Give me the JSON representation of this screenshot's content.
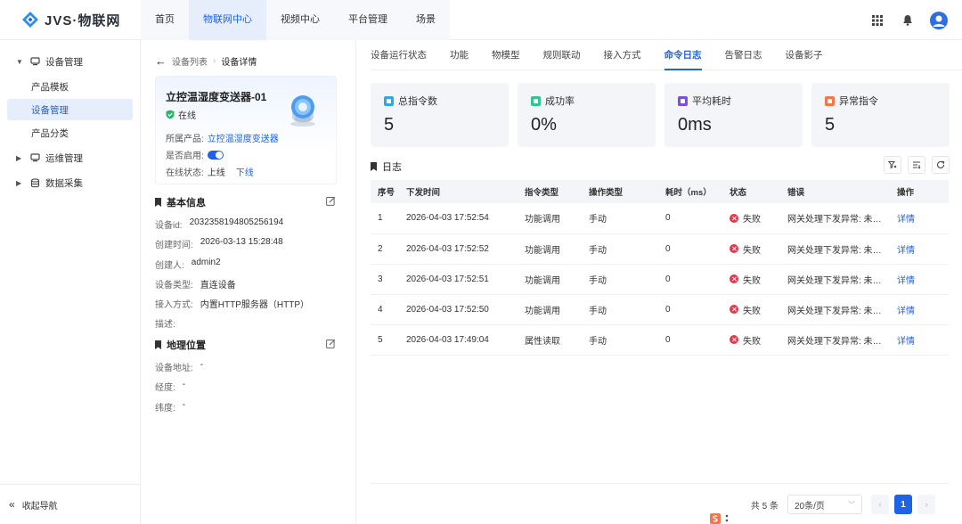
{
  "app": {
    "logo_text": "JVS·物联网"
  },
  "topnav": [
    {
      "label": "首页",
      "active": false
    },
    {
      "label": "物联网中心",
      "active": true
    },
    {
      "label": "视频中心",
      "active": false
    },
    {
      "label": "平台管理",
      "active": false
    },
    {
      "label": "场景",
      "active": false
    }
  ],
  "sidebar": {
    "group_device": "设备管理",
    "items": [
      "产品模板",
      "设备管理",
      "产品分类"
    ],
    "group_ops": "运维管理",
    "group_data": "数据采集",
    "collapse": "收起导航"
  },
  "breadcrumb": {
    "parent": "设备列表",
    "current": "设备详情"
  },
  "device": {
    "name": "立控温湿度变送器-01",
    "online": "在线",
    "product_label": "所属产品:",
    "product_value": "立控温湿度变送器",
    "enabled_label": "是否启用:",
    "status_label": "在线状态:",
    "status_value": "上线",
    "status_link": "下线"
  },
  "basic": {
    "title": "基本信息",
    "rows": [
      {
        "label": "设备id:",
        "value": "2032358194805256194"
      },
      {
        "label": "创建时间:",
        "value": "2026-03-13 15:28:48"
      },
      {
        "label": "创建人:",
        "value": "admin2"
      },
      {
        "label": "设备类型:",
        "value": "直连设备"
      },
      {
        "label": "接入方式:",
        "value": "内置HTTP服务器（HTTP）"
      },
      {
        "label": "描述:",
        "value": ""
      }
    ]
  },
  "geo": {
    "title": "地理位置",
    "rows": [
      {
        "label": "设备地址:",
        "value": "-"
      },
      {
        "label": "经度:",
        "value": "-"
      },
      {
        "label": "纬度:",
        "value": "-"
      }
    ]
  },
  "tabs": [
    "设备运行状态",
    "功能",
    "物模型",
    "规则联动",
    "接入方式",
    "命令日志",
    "告警日志",
    "设备影子"
  ],
  "active_tab": 5,
  "stats": [
    {
      "label": "总指令数",
      "value": "5",
      "color": "#2fa8e8"
    },
    {
      "label": "成功率",
      "value": "0%",
      "color": "#35c48f"
    },
    {
      "label": "平均耗时",
      "value": "0ms",
      "color": "#7b4fe0"
    },
    {
      "label": "异常指令",
      "value": "5",
      "color": "#f2774a"
    }
  ],
  "log": {
    "title": "日志",
    "columns": [
      "序号",
      "下发时间",
      "指令类型",
      "操作类型",
      "耗时（ms）",
      "状态",
      "错误",
      "操作"
    ],
    "rows": [
      {
        "no": "1",
        "time": "2026-04-03 17:52:54",
        "cmd": "功能调用",
        "op": "手动",
        "cost": "0",
        "status": "失败",
        "error": "网关处理下发异常: 未支持的指令",
        "action": "详情"
      },
      {
        "no": "2",
        "time": "2026-04-03 17:52:52",
        "cmd": "功能调用",
        "op": "手动",
        "cost": "0",
        "status": "失败",
        "error": "网关处理下发异常: 未支持的指令",
        "action": "详情"
      },
      {
        "no": "3",
        "time": "2026-04-03 17:52:51",
        "cmd": "功能调用",
        "op": "手动",
        "cost": "0",
        "status": "失败",
        "error": "网关处理下发异常: 未支持的指令",
        "action": "详情"
      },
      {
        "no": "4",
        "time": "2026-04-03 17:52:50",
        "cmd": "功能调用",
        "op": "手动",
        "cost": "0",
        "status": "失败",
        "error": "网关处理下发异常: 未支持的指令",
        "action": "详情"
      },
      {
        "no": "5",
        "time": "2026-04-03 17:49:04",
        "cmd": "属性读取",
        "op": "手动",
        "cost": "0",
        "status": "失败",
        "error": "网关处理下发异常: 未支持的指令",
        "action": "详情"
      }
    ]
  },
  "pagination": {
    "total": "共 5 条",
    "page_size": "20条/页",
    "current": "1"
  },
  "colors": {
    "primary": "#1e62e6",
    "fail": "#e8364b"
  }
}
